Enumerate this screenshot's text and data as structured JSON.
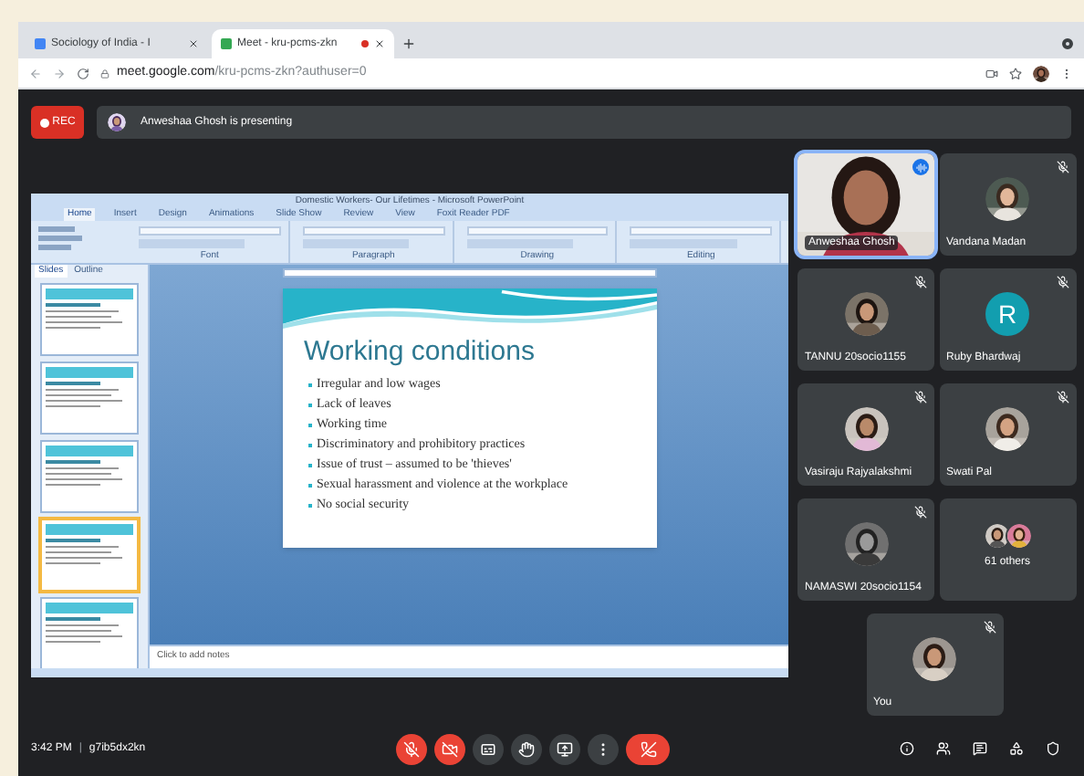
{
  "browser": {
    "tabs": [
      {
        "title": "Sociology of India - I",
        "selected": false,
        "recording": false
      },
      {
        "title": "Meet - kru-pcms-zkn",
        "selected": true,
        "recording": true
      }
    ],
    "url_host": "meet.google.com",
    "url_path": "/kru-pcms-zkn?authuser=0"
  },
  "meet": {
    "rec_label": "REC",
    "banner": "Anweshaa Ghosh is presenting"
  },
  "powerpoint": {
    "title": "Domestic Workers- Our Lifetimes - Microsoft PowerPoint",
    "ribbon_tabs": [
      {
        "label": "Home",
        "selected": true
      },
      {
        "label": "Insert",
        "selected": false
      },
      {
        "label": "Design",
        "selected": false
      },
      {
        "label": "Animations",
        "selected": false
      },
      {
        "label": "Slide Show",
        "selected": false
      },
      {
        "label": "Review",
        "selected": false
      },
      {
        "label": "View",
        "selected": false
      },
      {
        "label": "Foxit Reader PDF",
        "selected": false
      }
    ],
    "ribbon_groups": [
      "Font",
      "Paragraph",
      "Drawing",
      "Editing"
    ],
    "pane_tabs": [
      {
        "label": "Slides",
        "selected": true
      },
      {
        "label": "Outline",
        "selected": false
      }
    ],
    "thumbnails": [
      {
        "selected": false
      },
      {
        "selected": false
      },
      {
        "selected": false
      },
      {
        "selected": true
      },
      {
        "selected": false
      }
    ],
    "slide": {
      "title": "Working conditions",
      "bullets": [
        "Irregular and low wages",
        "Lack of leaves",
        "Working time",
        "Discriminatory and prohibitory practices",
        "Issue of trust – assumed to be 'thieves'",
        "Sexual harassment and violence at the workplace",
        "No social security"
      ]
    },
    "notes_placeholder": "Click to add notes"
  },
  "participants": [
    {
      "name": "Anweshaa Ghosh",
      "kind": "video",
      "muted": false,
      "speaking": true
    },
    {
      "name": "Vandana Madan",
      "muted": true,
      "speaking": false
    },
    {
      "name": "TANNU 20socio1155",
      "muted": true,
      "speaking": false
    },
    {
      "name": "Ruby Bhardwaj",
      "kind": "initial",
      "initial": "R",
      "muted": true,
      "speaking": false
    },
    {
      "name": "Vasiraju Rajyalakshmi",
      "muted": true,
      "speaking": false
    },
    {
      "name": "Swati Pal",
      "muted": true,
      "speaking": false
    },
    {
      "name": "NAMASWI 20socio1154",
      "muted": true,
      "speaking": false
    },
    {
      "name": "61 others",
      "kind": "others",
      "muted": false,
      "speaking": false
    }
  ],
  "self_tile": {
    "name": "You",
    "muted": true
  },
  "bottom_bar": {
    "time": "3:42 PM",
    "separator": "|",
    "meeting_code": "g7ib5dx2kn",
    "controls": [
      {
        "kind": "mic",
        "off": true
      },
      {
        "kind": "camera",
        "off": true
      },
      {
        "kind": "captions",
        "off": false
      },
      {
        "kind": "hand",
        "off": false
      },
      {
        "kind": "present",
        "off": false
      },
      {
        "kind": "more",
        "off": false
      },
      {
        "kind": "leave",
        "off": true
      }
    ]
  }
}
